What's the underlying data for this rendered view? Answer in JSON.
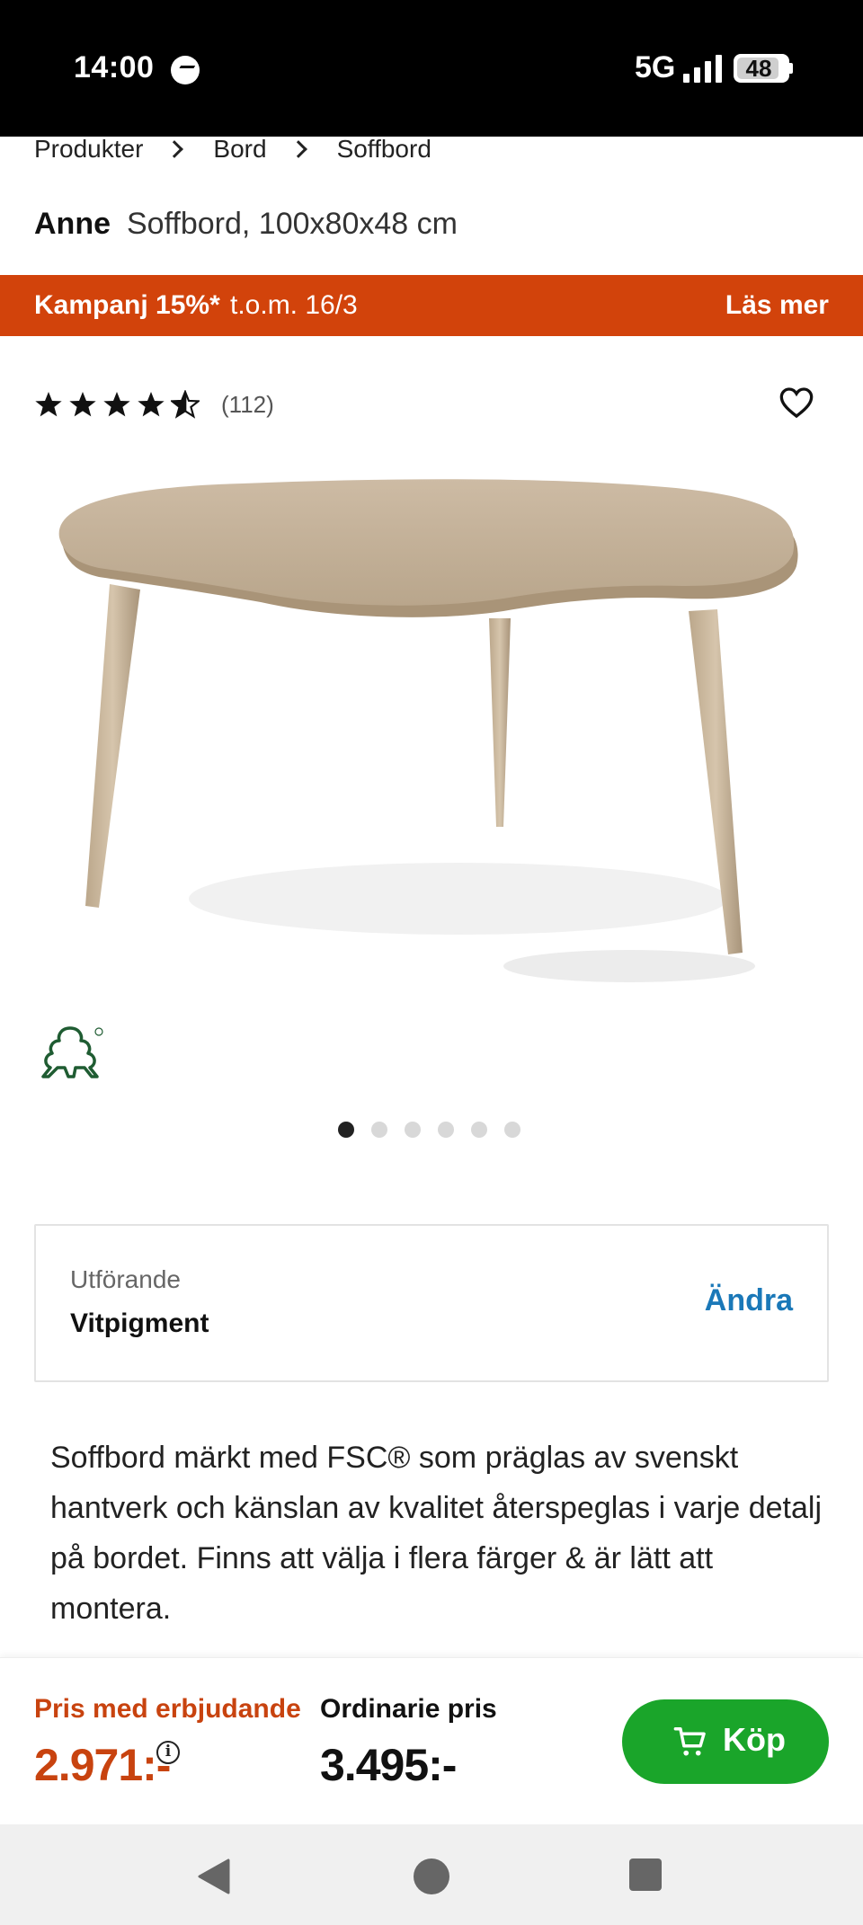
{
  "status_bar": {
    "time": "14:00",
    "network": "5G",
    "battery": "48",
    "icons": [
      "messenger-icon",
      "signal-icon",
      "battery-icon"
    ]
  },
  "breadcrumb": [
    "Produkter",
    "Bord",
    "Soffbord"
  ],
  "product": {
    "brand": "Anne",
    "name": "Soffbord, 100x80x48 cm"
  },
  "campaign": {
    "label": "Kampanj 15%*",
    "valid_until": "t.o.m. 16/3",
    "read_more": "Läs mer",
    "color": "#d2430b"
  },
  "rating": {
    "stars": 4.5,
    "max": 5,
    "count": "(112)"
  },
  "gallery": {
    "image_count": 6,
    "active_index": 0,
    "badge": "FSC"
  },
  "variant": {
    "label": "Utförande",
    "value": "Vitpigment",
    "change": "Ändra",
    "link_color": "#1a78b8"
  },
  "description": "Soffbord märkt med FSC® som präglas av svenskt hantverk och känslan av kvalitet återspeglas i varje detalj på bordet. Finns att välja i flera färger & är lätt att montera.",
  "purchase": {
    "offer_label": "Pris med erbjudande",
    "offer_price": "2.971:-",
    "regular_label": "Ordinarie pris",
    "regular_price": "3.495:-",
    "buy_label": "Köp",
    "buy_color": "#1aa52a"
  },
  "nav_bar": {
    "icons": [
      "back-icon",
      "home-icon",
      "recents-icon"
    ]
  }
}
